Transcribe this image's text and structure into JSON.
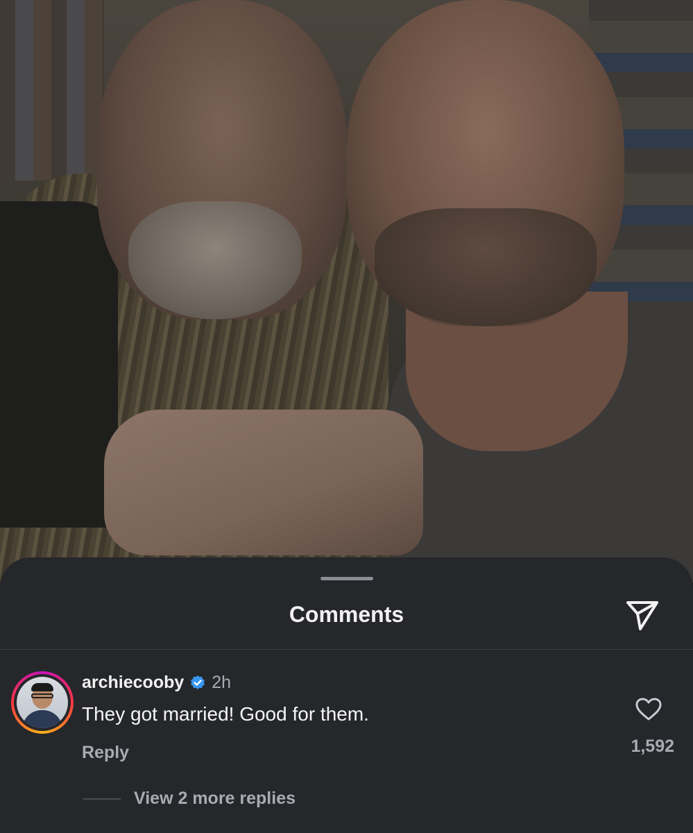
{
  "photo": {
    "description_icon": "photo-of-two-men"
  },
  "sheet": {
    "title": "Comments",
    "share_icon": "send-icon"
  },
  "comment": {
    "username": "archiecooby",
    "verified_icon": "verified-badge-icon",
    "time": "2h",
    "text": "They got married! Good for them.",
    "reply_label": "Reply",
    "like_icon": "heart-icon",
    "like_count": "1,592",
    "view_replies_label": "View 2 more replies"
  },
  "colors": {
    "sheet_bg": "#25272b",
    "text_primary": "#f2f2f2",
    "text_secondary": "#a8abb2",
    "verified_blue": "#3897f0"
  }
}
